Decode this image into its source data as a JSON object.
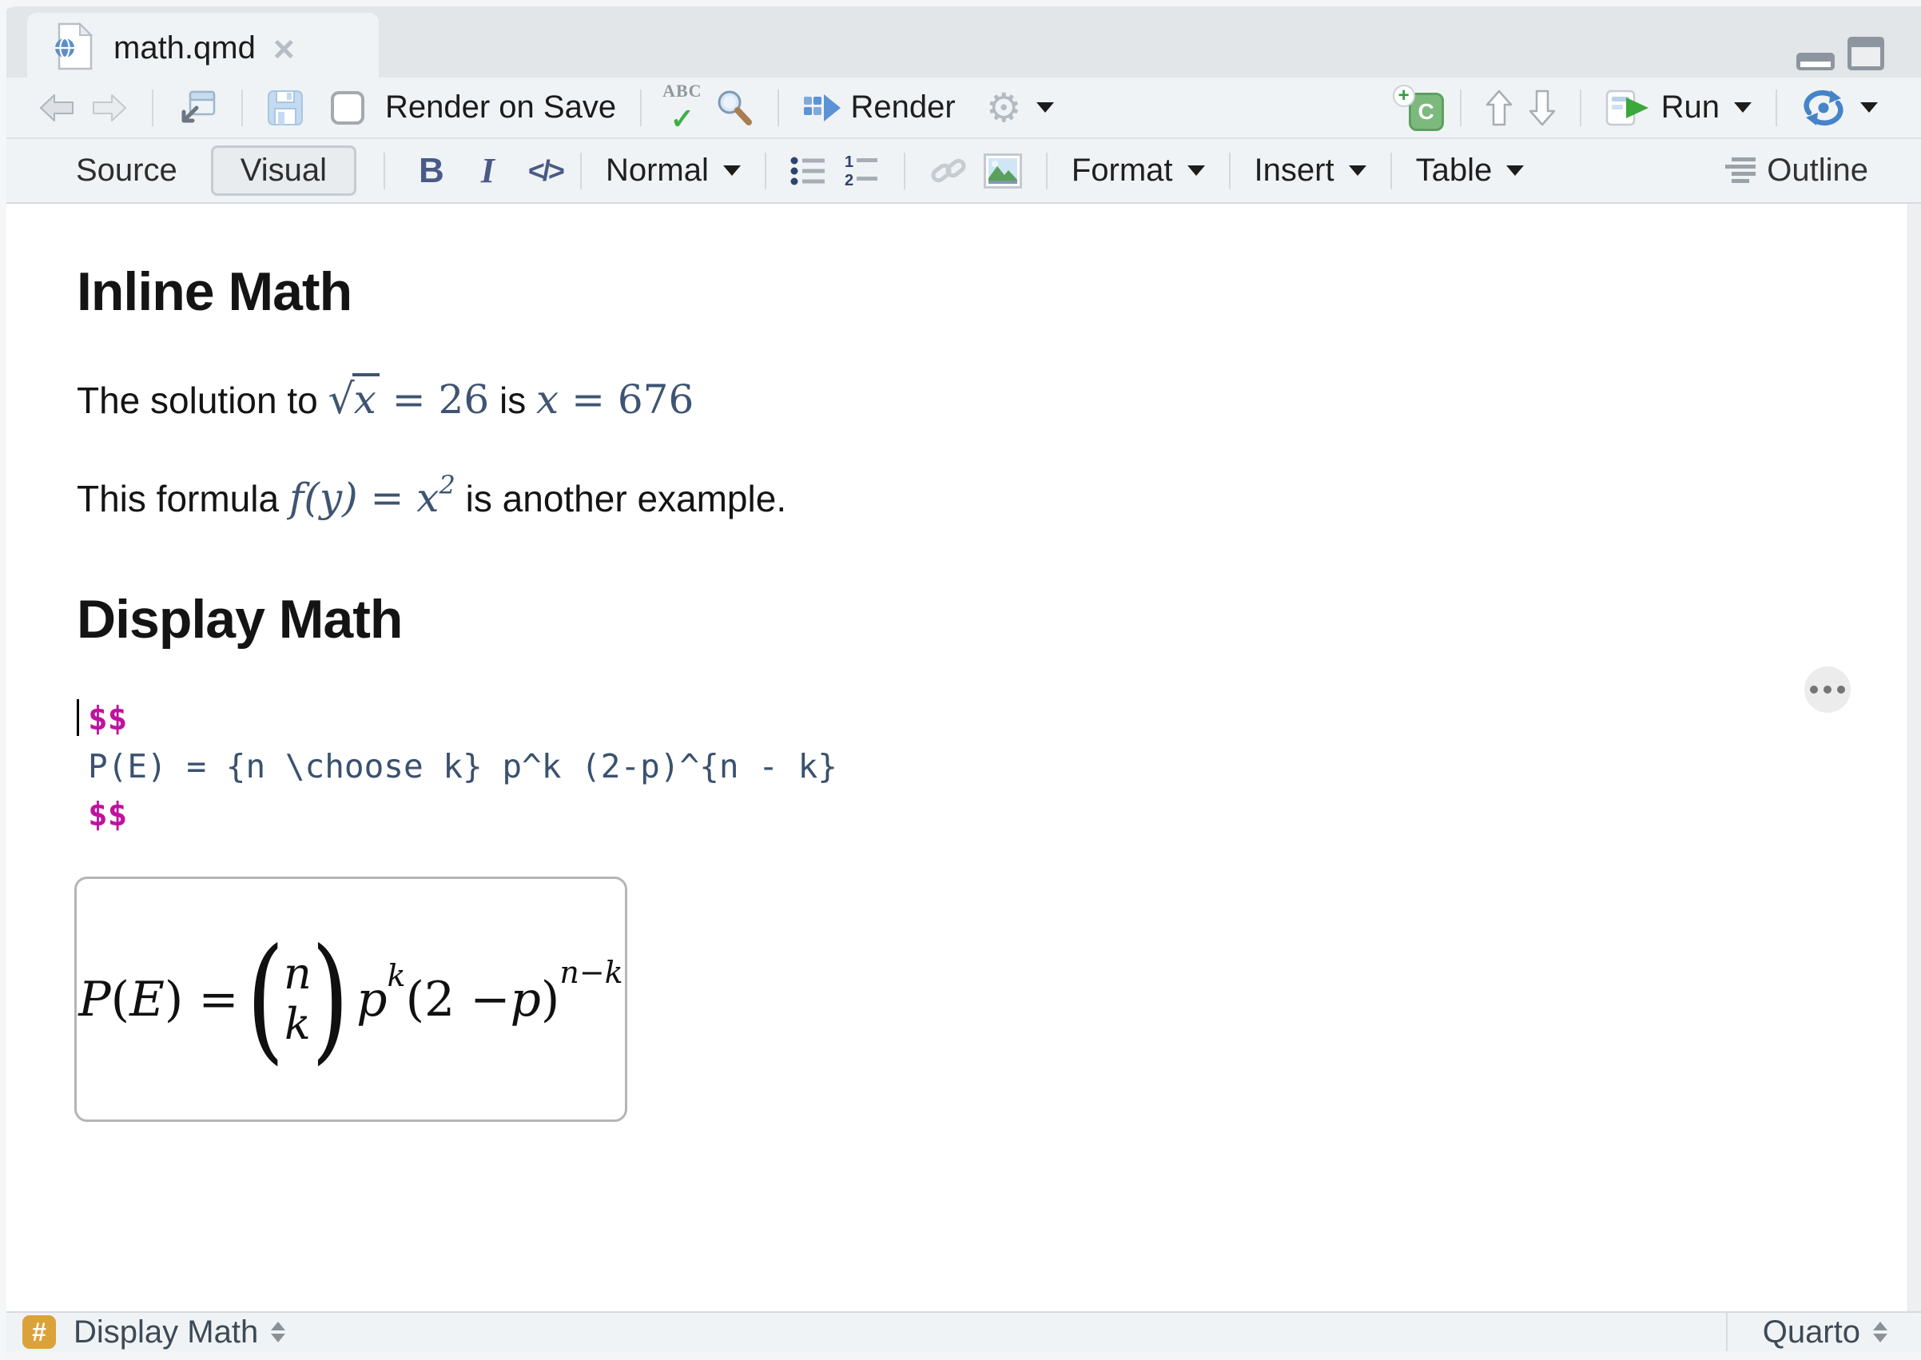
{
  "tab": {
    "title": "math.qmd",
    "close_glyph": "×"
  },
  "toolbar_main": {
    "render_on_save_label": "Render on Save",
    "render_label": "Render",
    "run_label": "Run",
    "spellcheck_abc": "ABC",
    "spellcheck_check": "✓",
    "gear_glyph": "⚙",
    "chunk_letter": "C",
    "chunk_plus": "+"
  },
  "toolbar_format": {
    "source_label": "Source",
    "visual_label": "Visual",
    "bold_glyph": "B",
    "italic_glyph": "I",
    "code_glyph": "</>",
    "paragraph_style": "Normal",
    "format_label": "Format",
    "insert_label": "Insert",
    "table_label": "Table",
    "outline_label": "Outline"
  },
  "content": {
    "heading_inline": "Inline Math",
    "heading_display": "Display Math",
    "para1": {
      "prefix": "The solution to ",
      "sqrt_symbol": "√",
      "sqrt_arg": "x",
      "sqrt_rhs": " = 26",
      "mid": " is ",
      "var": "x",
      "rhs": " = 676"
    },
    "para2": {
      "prefix": "This formula ",
      "func": "f(y) = x",
      "sup": "2",
      "suffix": " is another example."
    },
    "code": {
      "open_delim": "$$",
      "latex": "P(E) = {n \\choose k} p^k (2-p)^{n - k}",
      "close_delim": "$$"
    },
    "equation": {
      "P": "P",
      "lparen": "(",
      "E": "E",
      "rparen_eq": ") = ",
      "binom_paren_open": "(",
      "binom_top": "n",
      "binom_bottom": "k",
      "binom_paren_close": ")",
      "p_base": "p",
      "p_sup": "k",
      "factor_pre": "(2 − ",
      "factor_var": "p",
      "factor_post": ")",
      "factor_sup": "n−k"
    }
  },
  "statusbar": {
    "hash_glyph": "#",
    "block_type": "Display Math",
    "format_name": "Quarto"
  },
  "colors": {
    "math_inline_blue": "#3e5472",
    "code_delim_magenta": "#c011a1",
    "code_latex_blue": "#3a516f",
    "hash_badge_orange": "#dba23a",
    "render_accent_blue": "#5b93d6",
    "run_green": "#3aa83a",
    "chunk_green": "#7cb97d"
  }
}
